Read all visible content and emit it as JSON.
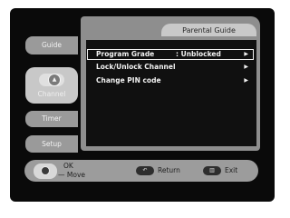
{
  "panel": {
    "title": "Parental Guide"
  },
  "sidebar": {
    "items": [
      {
        "label": "Guide"
      },
      {
        "label": "Channel",
        "icon": "channel-up-icon",
        "active": true
      },
      {
        "label": "Timer"
      },
      {
        "label": "Setup"
      }
    ]
  },
  "menu": {
    "items": [
      {
        "label": "Program Grade",
        "value": ": Unblocked",
        "arrow": "▶",
        "selected": true
      },
      {
        "label": "Lock/Unlock Channel",
        "value": "",
        "arrow": "▶",
        "selected": false
      },
      {
        "label": "Change PIN code",
        "value": "",
        "arrow": "▶",
        "selected": false
      }
    ]
  },
  "footer": {
    "ok_label": "OK",
    "move_label": "— Move",
    "return_label": "Return",
    "exit_label": "Exit",
    "return_icon": "return-icon",
    "exit_icon": "exit-icon"
  },
  "colors": {
    "screen_bg": "#0a0a0a",
    "panel_gray": "#8e8e8e",
    "tab_gray": "#9a9a9a",
    "text_light": "#f2f2f2"
  }
}
